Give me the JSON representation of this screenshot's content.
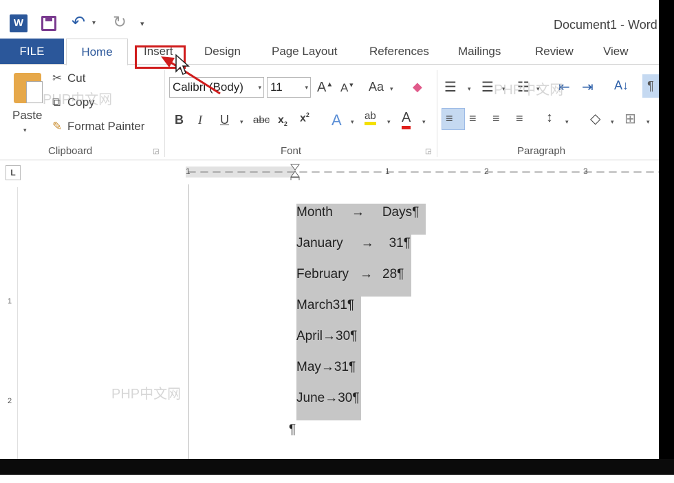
{
  "titlebar": {
    "app_icon": "word-icon",
    "app_letter": "W",
    "title": "Document1 - Word"
  },
  "tabs": [
    "FILE",
    "Home",
    "Insert",
    "Design",
    "Page Layout",
    "References",
    "Mailings",
    "Review",
    "View"
  ],
  "active_tab": "Home",
  "clipboard": {
    "paste": "Paste",
    "cut": "Cut",
    "copy": "Copy",
    "format_painter": "Format Painter",
    "label": "Clipboard"
  },
  "font": {
    "family": "Calibri (Body)",
    "size": "11",
    "case_btn": "Aa",
    "label": "Font"
  },
  "paragraph": {
    "label": "Paragraph"
  },
  "ruler": {
    "numbers": [
      "1",
      "1",
      "2",
      "3"
    ]
  },
  "vruler": {
    "numbers": [
      "1",
      "2"
    ]
  },
  "document": {
    "lines": [
      {
        "left": "Month",
        "tab": "→",
        "right": "Days¶"
      },
      {
        "left": "January",
        "tab": "→",
        "right": "31¶"
      },
      {
        "left": "February",
        "tab": "→",
        "right": "28¶"
      },
      {
        "left": "March",
        "tab": "",
        "right": "31¶"
      },
      {
        "left": "April",
        "tab": "→",
        "right": "30¶"
      },
      {
        "left": "May",
        "tab": "→",
        "right": "31¶"
      },
      {
        "left": "June",
        "tab": "→",
        "right": "30¶"
      }
    ],
    "end_mark": "¶"
  },
  "watermark": "PHP中文网",
  "colors": {
    "word_blue": "#2b579a",
    "selection": "#c6c6c6",
    "annotation_red": "#d01c1c"
  }
}
